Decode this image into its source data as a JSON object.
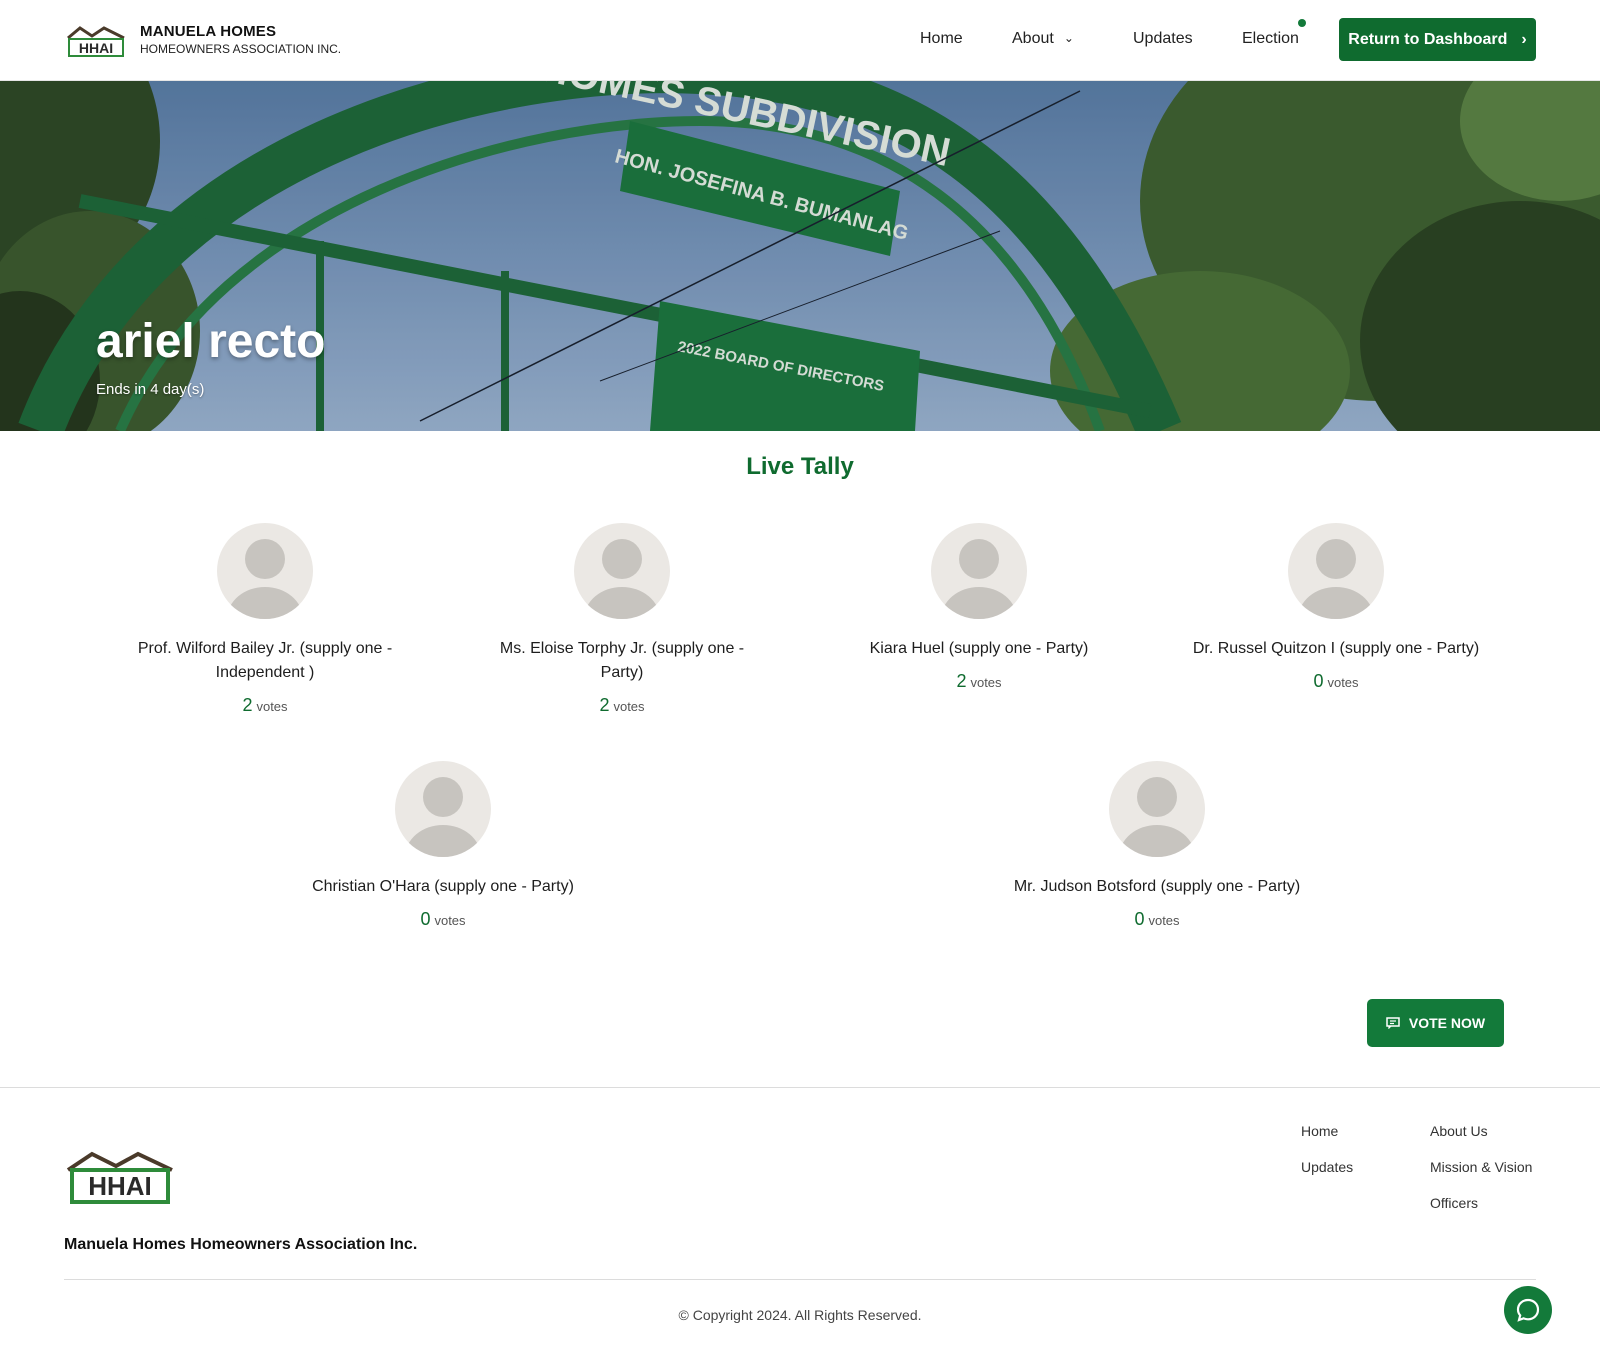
{
  "header": {
    "brand_title": "MANUELA HOMES",
    "brand_subtitle": "HOMEOWNERS ASSOCIATION INC.",
    "logo_text": "HHAI",
    "nav": {
      "home": "Home",
      "about": "About",
      "updates": "Updates",
      "election": "Election"
    },
    "dashboard_button": "Return to Dashboard"
  },
  "hero": {
    "title": "ariel recto",
    "subtitle": "Ends in 4 day(s)",
    "sign_text": "MANUELA HOMES SUBDIVISION"
  },
  "tally": {
    "title": "Live Tally",
    "votes_label": "votes",
    "candidates": [
      {
        "name": "Prof. Wilford Bailey Jr. (supply one - Independent )",
        "votes": "2"
      },
      {
        "name": "Ms. Eloise Torphy Jr. (supply one - Party)",
        "votes": "2"
      },
      {
        "name": "Kiara Huel (supply one - Party)",
        "votes": "2"
      },
      {
        "name": "Dr. Russel Quitzon I (supply one - Party)",
        "votes": "0"
      },
      {
        "name": "Christian O'Hara (supply one - Party)",
        "votes": "0"
      },
      {
        "name": "Mr. Judson Botsford (supply one - Party)",
        "votes": "0"
      }
    ],
    "vote_button": "VOTE NOW"
  },
  "footer": {
    "org_name": "Manuela Homes Homeowners Association Inc.",
    "links": {
      "home": "Home",
      "updates": "Updates",
      "about_us": "About Us",
      "mission_vision": "Mission & Vision",
      "officers": "Officers"
    },
    "copyright": "© Copyright 2024. All Rights Reserved."
  },
  "colors": {
    "brand_green": "#0f6b2f",
    "accent_green": "#137a3a"
  }
}
